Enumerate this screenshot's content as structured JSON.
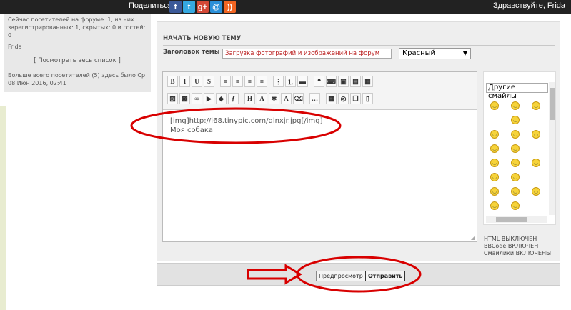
{
  "topbar": {
    "share_label": "Поделиться :",
    "share_icons": [
      {
        "name": "facebook-icon",
        "glyph": "f",
        "color": "#3b5998"
      },
      {
        "name": "twitter-icon",
        "glyph": "t",
        "color": "#35a8e0"
      },
      {
        "name": "googleplus-icon",
        "glyph": "g+",
        "color": "#d34836"
      },
      {
        "name": "email-icon",
        "glyph": "@",
        "color": "#2a8fd8"
      },
      {
        "name": "rss-icon",
        "glyph": "))",
        "color": "#f26522"
      }
    ],
    "greeting": "Здравствуйте, Frida"
  },
  "sidebar": {
    "visitors_text": "Сейчас посетителей на форуме: 1, из них зарегистрированных: 1, скрытых: 0 и гостей: 0",
    "user": "Frida",
    "view_all": "[ Посмотреть весь список ]",
    "record_text": "Больше всего посетителей (5) здесь было Ср 08 Июн 2016, 02:41"
  },
  "form": {
    "title": "НАЧАТЬ НОВУЮ ТЕМУ",
    "subject_label": "Заголовок темы",
    "subject_value": "Загрузка фотографий и изображений на форум",
    "color_value": "Красный",
    "editor_lines": [
      "[img]http://i68.tinypic.com/dlnxjr.jpg[/img]",
      "Моя собака"
    ],
    "toolbar_row1": [
      {
        "name": "bold-icon",
        "glyph": "B"
      },
      {
        "name": "italic-icon",
        "glyph": "I"
      },
      {
        "name": "underline-icon",
        "glyph": "U"
      },
      {
        "name": "strike-icon",
        "glyph": "S"
      },
      {
        "gap": true
      },
      {
        "name": "align-left-icon",
        "glyph": "≡"
      },
      {
        "name": "align-center-icon",
        "glyph": "≡"
      },
      {
        "name": "align-right-icon",
        "glyph": "≡"
      },
      {
        "name": "align-justify-icon",
        "glyph": "≡"
      },
      {
        "gap": true
      },
      {
        "name": "bullet-list-icon",
        "glyph": "⋮"
      },
      {
        "name": "numbered-list-icon",
        "glyph": "⒈"
      },
      {
        "name": "hr-icon",
        "glyph": "▬"
      },
      {
        "gap": true
      },
      {
        "name": "quote-icon",
        "glyph": "❝"
      },
      {
        "name": "code-icon",
        "glyph": "⌨"
      },
      {
        "name": "spoiler-icon",
        "glyph": "▣"
      },
      {
        "name": "hide-icon",
        "glyph": "▤"
      },
      {
        "name": "table-icon",
        "glyph": "▦"
      }
    ],
    "toolbar_row2": [
      {
        "name": "image-icon",
        "glyph": "▨"
      },
      {
        "name": "hosting-icon",
        "glyph": "▩"
      },
      {
        "name": "link-icon",
        "glyph": "∞"
      },
      {
        "name": "youtube-icon",
        "glyph": "▶"
      },
      {
        "name": "dailymotion-icon",
        "glyph": "◆"
      },
      {
        "name": "flash-icon",
        "glyph": "ƒ"
      },
      {
        "gap": true
      },
      {
        "name": "heading-icon",
        "glyph": "H"
      },
      {
        "name": "font-size-icon",
        "glyph": "A"
      },
      {
        "name": "color-icon",
        "glyph": "✱"
      },
      {
        "name": "font-icon",
        "glyph": "A"
      },
      {
        "name": "eraser-icon",
        "glyph": "⌫"
      },
      {
        "gap": true
      },
      {
        "name": "more-icon",
        "glyph": "…"
      },
      {
        "gap": true
      },
      {
        "name": "calendar-icon",
        "glyph": "▦"
      },
      {
        "name": "search-icon",
        "glyph": "◎"
      },
      {
        "name": "copy-icon",
        "glyph": "❐"
      },
      {
        "name": "source-icon",
        "glyph": "▯"
      }
    ],
    "smiley_select": "Другие смайлы",
    "status": [
      "HTML ВЫКЛЮЧЕН",
      "BBCode ВКЛЮЧЕН",
      "Смайлики ВКЛЮЧЕНЫ"
    ]
  },
  "buttons": {
    "preview": "Предпросмотр",
    "submit": "Отправить"
  },
  "annotations": {
    "color": "#d80000"
  }
}
